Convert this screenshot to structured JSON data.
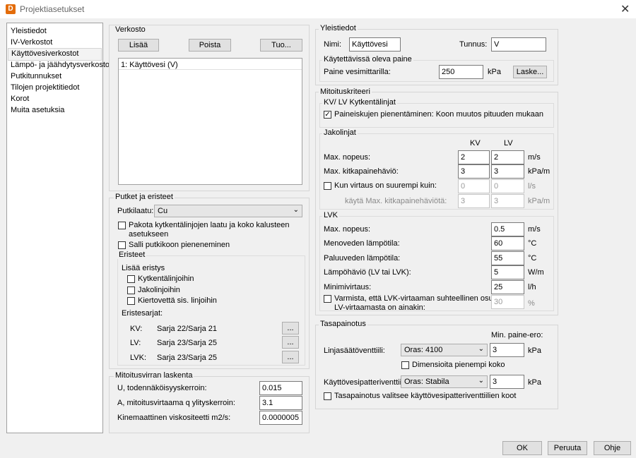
{
  "window": {
    "title": "Projektiasetukset",
    "app_icon_letter": "D",
    "close_glyph": "✕"
  },
  "nav": [
    "Yleistiedot",
    "IV-Verkostot",
    "Käyttövesiverkostot",
    "Lämpö- ja jäähdytysverkostot",
    "Putkitunnukset",
    "Tilojen projektitiedot",
    "Korot",
    "Muita asetuksia"
  ],
  "verkosto": {
    "title": "Verkosto",
    "add": "Lisää",
    "remove": "Poista",
    "import": "Tuo...",
    "items": [
      "1: Käyttövesi (V)"
    ]
  },
  "putket": {
    "title": "Putket ja eristeet",
    "material_label": "Putkilaatu:",
    "material_value": "Cu",
    "force_label_1": "Pakota kytkentälinjojen laatu ja koko kalusteen",
    "force_label_2": "asetukseen",
    "allow_shrink_label": "Salli putkikoon pieneneminen",
    "eristeet": {
      "title": "Eristeet",
      "add_insulation": "Lisää eristys",
      "opt1": "Kytkentälinjoihin",
      "opt2": "Jakolinjoihin",
      "opt3": "Kiertovettä sis. linjoihin",
      "series_label": "Eristesarjat:",
      "rows": [
        {
          "key": "KV:",
          "value": "Sarja 22/Sarja 21",
          "btn": "..."
        },
        {
          "key": "LV:",
          "value": "Sarja 23/Sarja 25",
          "btn": "..."
        },
        {
          "key": "LVK:",
          "value": "Sarja 23/Sarja 25",
          "btn": "..."
        }
      ]
    }
  },
  "mitoitusvirta": {
    "title": "Mitoitusvirran laskenta",
    "rows": [
      {
        "label": "U, todennäköisyyskerroin:",
        "value": "0.015"
      },
      {
        "label": "A, mitoitusvirtaama q ylityskerroin:",
        "value": "3.1"
      },
      {
        "label": "Kinemaattinen viskositeetti  m2/s:",
        "value": "0.00000051"
      }
    ]
  },
  "yleistiedot": {
    "title": "Yleistiedot",
    "name_label": "Nimi:",
    "name_value": "Käyttövesi",
    "code_label": "Tunnus:",
    "code_value": "V",
    "pressure_title": "Käytettävissä oleva paine",
    "pressure_label": "Paine vesimittarilla:",
    "pressure_value": "250",
    "pressure_unit": "kPa",
    "calc_btn": "Laske..."
  },
  "mitoitus": {
    "title": "Mitoituskriteeri",
    "kytkenta": {
      "title": "KV/ LV Kytkentälinjat",
      "reduce_label": "Paineiskujen pienentäminen: Koon muutos pituuden mukaan"
    },
    "jakolinjat": {
      "title": "Jakolinjat",
      "col_kv": "KV",
      "col_lv": "LV",
      "maxspeed_label": "Max. nopeus:",
      "maxspeed_kv": "2",
      "maxspeed_lv": "2",
      "maxspeed_unit": "m/s",
      "friction_label": "Max. kitkapainehäviö:",
      "friction_kv": "3",
      "friction_lv": "3",
      "friction_unit": "kPa/m",
      "flow_label": "Kun virtaus on suurempi kuin:",
      "flow_kv": "0",
      "flow_lv": "0",
      "flow_unit": "l/s",
      "use_label": "käytä Max. kitkapainehäviötä:",
      "use_kv": "3",
      "use_lv": "3",
      "use_unit": "kPa/m"
    },
    "lvk": {
      "title": "LVK",
      "rows": [
        {
          "label": "Max. nopeus:",
          "value": "0.5",
          "unit": "m/s"
        },
        {
          "label": "Menoveden lämpötila:",
          "value": "60",
          "unit": "°C"
        },
        {
          "label": "Paluuveden lämpötila:",
          "value": "55",
          "unit": "°C"
        },
        {
          "label": "Lämpöhäviö (LV tai LVK):",
          "value": "5",
          "unit": "W/m"
        },
        {
          "label": "Minimivirtaus:",
          "value": "25",
          "unit": "l/h"
        }
      ],
      "ensure_label_1": "Varmista, että LVK-virtaaman suhteellinen osuus",
      "ensure_label_2": "LV-virtaamasta on ainakin:",
      "ensure_value": "30",
      "ensure_unit": "%"
    }
  },
  "tasapainotus": {
    "title": "Tasapainotus",
    "minp_label": "Min. paine-ero:",
    "valve_label": "Linjasäätöventtiili:",
    "valve_value": "Oras: 4100",
    "valve_p": "3",
    "valve_unit": "kPa",
    "dim_smaller_label": "Dimensioita pienempi koko",
    "rad_label": "Käyttövesipatteriventtiili:",
    "rad_value": "Oras: Stabila",
    "rad_p": "3",
    "rad_unit": "kPa",
    "auto_label": "Tasapainotus valitsee käyttövesipatteriventtiilien koot"
  },
  "footer": {
    "ok": "OK",
    "cancel": "Peruuta",
    "help": "Ohje"
  }
}
